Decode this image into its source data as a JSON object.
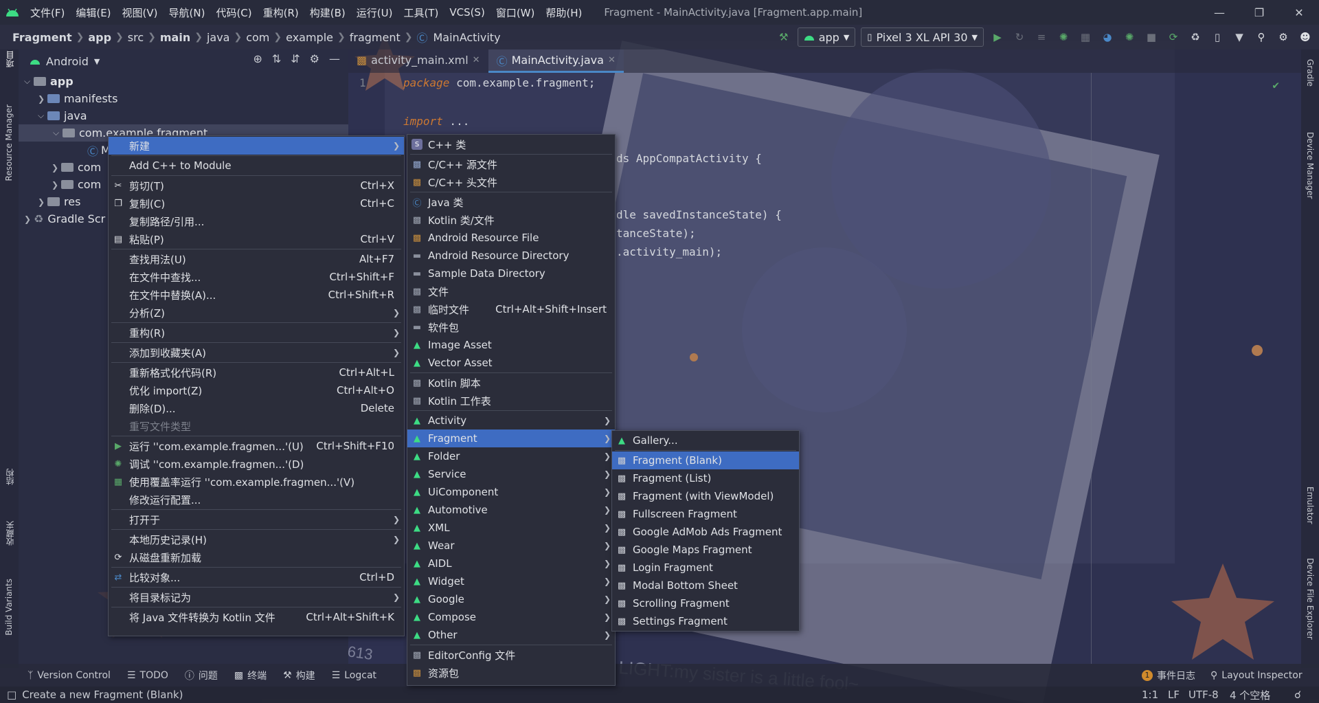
{
  "window": {
    "title": "Fragment - MainActivity.java [Fragment.app.main]",
    "menus": [
      "文件(F)",
      "编辑(E)",
      "视图(V)",
      "导航(N)",
      "代码(C)",
      "重构(R)",
      "构建(B)",
      "运行(U)",
      "工具(T)",
      "VCS(S)",
      "窗口(W)",
      "帮助(H)"
    ]
  },
  "breadcrumbs": [
    "Fragment",
    "app",
    "src",
    "main",
    "java",
    "com",
    "example",
    "fragment",
    "MainActivity"
  ],
  "toolbar": {
    "run_config": "app",
    "device": "Pixel 3 XL API 30"
  },
  "left_strip": {
    "project": "项目",
    "resource_manager": "Resource Manager",
    "structure": "结构",
    "favorites": "收藏夹",
    "build_variants": "Build Variants"
  },
  "right_strip": {
    "gradle": "Gradle",
    "device_manager": "Device Manager",
    "emulator": "Emulator",
    "device_file_explorer": "Device File Explorer"
  },
  "project_panel": {
    "view_mode": "Android",
    "tree": [
      {
        "label": "app"
      },
      {
        "label": "manifests"
      },
      {
        "label": "java"
      },
      {
        "label": "com.example.fragment"
      },
      {
        "label": "M"
      },
      {
        "label": "com"
      },
      {
        "label": "com"
      },
      {
        "label": "res"
      },
      {
        "label": "Gradle Scr"
      }
    ]
  },
  "editor": {
    "tabs": [
      {
        "label": "activity_main.xml"
      },
      {
        "label": "MainActivity.java"
      }
    ],
    "line1_num": "1",
    "line1_kw": "package",
    "line1_rest": " com.example.fragment;",
    "import_kw": "import",
    "import_rest": " ...",
    "frag_extends": "ds AppCompatActivity {",
    "frag_oncreate": "dle savedInstanceState) {",
    "frag_super": "tanceState);",
    "frag_layout": ".activity_main);"
  },
  "context_menu": {
    "items": [
      {
        "label": "新建",
        "shortcut": ""
      },
      {
        "label": "Add C++ to Module",
        "shortcut": ""
      },
      {
        "label": "剪切(T)",
        "shortcut": "Ctrl+X"
      },
      {
        "label": "复制(C)",
        "shortcut": "Ctrl+C"
      },
      {
        "label": "复制路径/引用...",
        "shortcut": ""
      },
      {
        "label": "粘贴(P)",
        "shortcut": "Ctrl+V"
      },
      {
        "label": "查找用法(U)",
        "shortcut": "Alt+F7"
      },
      {
        "label": "在文件中查找...",
        "shortcut": "Ctrl+Shift+F"
      },
      {
        "label": "在文件中替换(A)...",
        "shortcut": "Ctrl+Shift+R"
      },
      {
        "label": "分析(Z)",
        "shortcut": ""
      },
      {
        "label": "重构(R)",
        "shortcut": ""
      },
      {
        "label": "添加到收藏夹(A)",
        "shortcut": ""
      },
      {
        "label": "重新格式化代码(R)",
        "shortcut": "Ctrl+Alt+L"
      },
      {
        "label": "优化 import(Z)",
        "shortcut": "Ctrl+Alt+O"
      },
      {
        "label": "删除(D)...",
        "shortcut": "Delete"
      },
      {
        "label": "重写文件类型",
        "shortcut": ""
      },
      {
        "label": "运行 ''com.example.fragmen...'(U)",
        "shortcut": "Ctrl+Shift+F10"
      },
      {
        "label": "调试 ''com.example.fragmen...'(D)",
        "shortcut": ""
      },
      {
        "label": "使用覆盖率运行 ''com.example.fragmen...'(V)",
        "shortcut": ""
      },
      {
        "label": "修改运行配置...",
        "shortcut": ""
      },
      {
        "label": "打开于",
        "shortcut": ""
      },
      {
        "label": "本地历史记录(H)",
        "shortcut": ""
      },
      {
        "label": "从磁盘重新加载",
        "shortcut": ""
      },
      {
        "label": "比较对象...",
        "shortcut": "Ctrl+D"
      },
      {
        "label": "将目录标记为",
        "shortcut": ""
      },
      {
        "label": "将 Java 文件转换为 Kotlin 文件",
        "shortcut": "Ctrl+Alt+Shift+K"
      }
    ]
  },
  "new_menu": {
    "items": [
      {
        "label": "C++ 类",
        "shortcut": ""
      },
      {
        "label": "C/C++ 源文件",
        "shortcut": ""
      },
      {
        "label": "C/C++ 头文件",
        "shortcut": ""
      },
      {
        "label": "Java 类",
        "shortcut": ""
      },
      {
        "label": "Kotlin 类/文件",
        "shortcut": ""
      },
      {
        "label": "Android Resource File",
        "shortcut": ""
      },
      {
        "label": "Android Resource Directory",
        "shortcut": ""
      },
      {
        "label": "Sample Data Directory",
        "shortcut": ""
      },
      {
        "label": "文件",
        "shortcut": ""
      },
      {
        "label": "临时文件",
        "shortcut": "Ctrl+Alt+Shift+Insert"
      },
      {
        "label": "软件包",
        "shortcut": ""
      },
      {
        "label": "Image Asset",
        "shortcut": ""
      },
      {
        "label": "Vector Asset",
        "shortcut": ""
      },
      {
        "label": "Kotlin 脚本",
        "shortcut": ""
      },
      {
        "label": "Kotlin 工作表",
        "shortcut": ""
      },
      {
        "label": "Activity",
        "shortcut": ""
      },
      {
        "label": "Fragment",
        "shortcut": ""
      },
      {
        "label": "Folder",
        "shortcut": ""
      },
      {
        "label": "Service",
        "shortcut": ""
      },
      {
        "label": "UiComponent",
        "shortcut": ""
      },
      {
        "label": "Automotive",
        "shortcut": ""
      },
      {
        "label": "XML",
        "shortcut": ""
      },
      {
        "label": "Wear",
        "shortcut": ""
      },
      {
        "label": "AIDL",
        "shortcut": ""
      },
      {
        "label": "Widget",
        "shortcut": ""
      },
      {
        "label": "Google",
        "shortcut": ""
      },
      {
        "label": "Compose",
        "shortcut": ""
      },
      {
        "label": "Other",
        "shortcut": ""
      },
      {
        "label": "EditorConfig 文件",
        "shortcut": ""
      },
      {
        "label": "资源包",
        "shortcut": ""
      }
    ]
  },
  "fragment_menu": {
    "items": [
      {
        "label": "Gallery..."
      },
      {
        "label": "Fragment (Blank)"
      },
      {
        "label": "Fragment (List)"
      },
      {
        "label": "Fragment (with ViewModel)"
      },
      {
        "label": "Fullscreen Fragment"
      },
      {
        "label": "Google AdMob Ads Fragment"
      },
      {
        "label": "Google Maps Fragment"
      },
      {
        "label": "Login Fragment"
      },
      {
        "label": "Modal Bottom Sheet"
      },
      {
        "label": "Scrolling Fragment"
      },
      {
        "label": "Settings Fragment"
      }
    ]
  },
  "bottom_tools": {
    "version_control": "Version Control",
    "todo": "TODO",
    "problems": "问题",
    "terminal": "终端",
    "build": "构建",
    "logcat": "Logcat",
    "event_log": "事件日志",
    "event_count": "1",
    "layout_inspector": "Layout Inspector"
  },
  "status": {
    "message": "Create a new Fragment (Blank)",
    "position": "1:1",
    "line_sep": "LF",
    "encoding": "UTF-8",
    "indent": "4 个空格"
  },
  "background": {
    "caption": "LIGHT:my sister is a little fool~",
    "corner": "613"
  },
  "colors": {
    "accent": "#3e6cc2",
    "android_green": "#3ddc84",
    "run_green": "#59a869"
  }
}
